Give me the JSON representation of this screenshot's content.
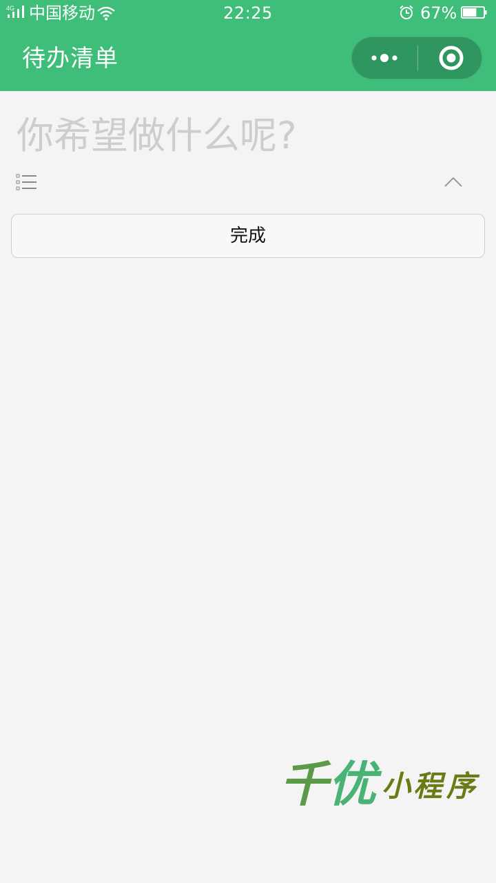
{
  "status_bar": {
    "network": "4G",
    "carrier": "中国移动",
    "time": "22:25",
    "battery_percent": "67%",
    "battery_level": 0.67,
    "icons": [
      "signal-icon",
      "wifi-icon",
      "alarm-icon",
      "battery-icon"
    ]
  },
  "nav": {
    "title": "待办清单",
    "bar_color": "#3fbe7a",
    "capsule_icons": [
      "more-dots-icon",
      "close-target-icon"
    ]
  },
  "todo": {
    "placeholder": "你希望做什么呢?",
    "value": "",
    "list_toggle_icon": "list-icon",
    "collapse_icon": "chevron-up-icon",
    "done_label": "完成"
  },
  "watermark": {
    "brand_big_1": "千",
    "brand_big_2": "优",
    "brand_small_1": "小",
    "brand_small_2": "程",
    "brand_small_3": "序"
  }
}
